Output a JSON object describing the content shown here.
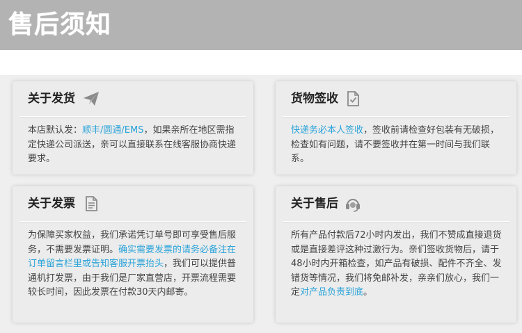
{
  "banner": {
    "title": "售后须知"
  },
  "cards": [
    {
      "title": "关于发货",
      "icon": "paper-plane-icon",
      "segments": [
        {
          "text": "本店默认发：",
          "highlight": false
        },
        {
          "text": "顺丰/圆通/EMS",
          "highlight": true
        },
        {
          "text": "，如果亲所在地区需指定快递公司派送，亲可以直接联系在线客服协商快递要求。",
          "highlight": false
        }
      ]
    },
    {
      "title": "货物签收",
      "icon": "document-check-icon",
      "segments": [
        {
          "text": "快递务必本人签收",
          "highlight": true
        },
        {
          "text": "，签收前请检查好包装有无破损，检查如有问题，请不要签收并在第一时间与我们联系。",
          "highlight": false
        }
      ]
    },
    {
      "title": "关于发票",
      "icon": "invoice-document-icon",
      "segments": [
        {
          "text": "为保障买家权益，我们承诺凭订单号即可享受售后服务，不需要发票证明。",
          "highlight": false
        },
        {
          "text": "确实需要发票的请务必备注在订单留言栏里或告知客服开票抬头",
          "highlight": true
        },
        {
          "text": "，我们可以提供普通机打发票，由于我们是厂家直营店，开票流程需要较长时间，因此发票在付款30天内邮寄。",
          "highlight": false
        }
      ]
    },
    {
      "title": "关于售后",
      "icon": "headset-icon",
      "segments": [
        {
          "text": "所有产品付款后72小时内发出，我们不赞成直接退货或是直接差评这种过激行为。亲们签收货物后，请于48小时内开箱检查，如产品有破损、配件不齐全、发错货等情况，我们将免邮补发，亲亲们放心，我们一定",
          "highlight": false
        },
        {
          "text": "对产品负责到底",
          "highlight": true
        },
        {
          "text": "。",
          "highlight": false
        }
      ]
    }
  ],
  "colors": {
    "banner": "#b3b3b3",
    "highlight": "#2aa3d9",
    "card": "#ececec"
  }
}
